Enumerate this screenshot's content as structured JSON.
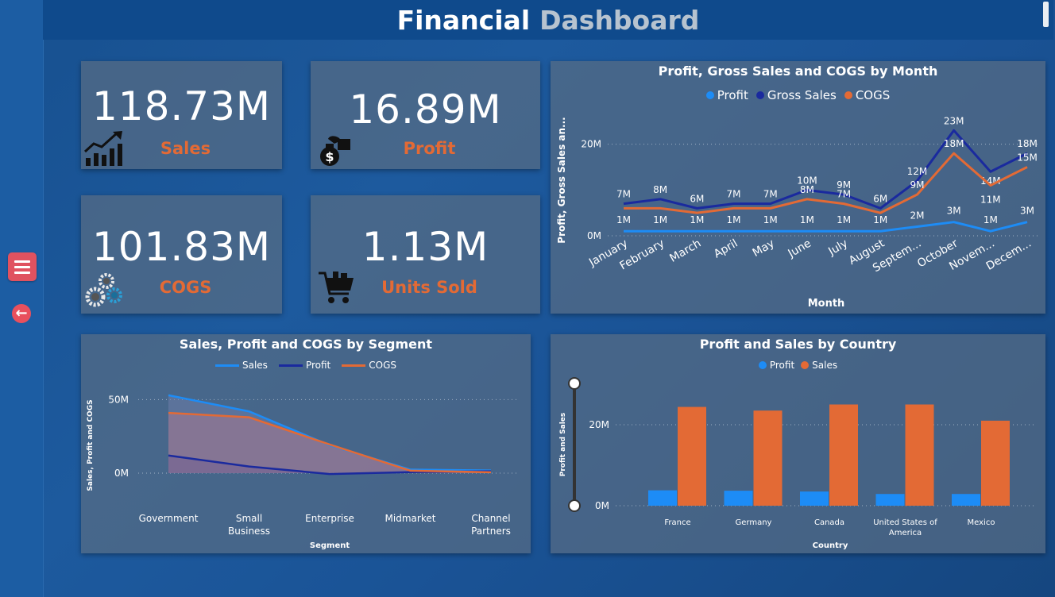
{
  "header": {
    "title_word1": "Financial",
    "title_word2": "Dashboard"
  },
  "kpis": {
    "sales": {
      "value": "118.73M",
      "label": "Sales"
    },
    "profit": {
      "value": "16.89M",
      "label": "Profit"
    },
    "cogs": {
      "value": "101.83M",
      "label": "COGS"
    },
    "units": {
      "value": "1.13M",
      "label": "Units Sold"
    }
  },
  "icons": {
    "sales": "chart-growth-icon",
    "profit": "money-bag-icon",
    "cogs": "gears-icon",
    "units": "shopping-cart-icon",
    "menu": "hamburger-menu-icon",
    "back": "back-arrow-icon"
  },
  "colors": {
    "accent_orange": "#e36a35",
    "profit_blue": "#1d8cf6",
    "gross_sales_navy": "#1a2a9e",
    "cogs_orange": "#e36a35"
  },
  "chart_data": [
    {
      "type": "line",
      "title": "Profit, Gross Sales and COGS by Month",
      "xlabel": "Month",
      "ylabel": "Profit, Gross Sales an...",
      "categories": [
        "January",
        "February",
        "March",
        "April",
        "May",
        "June",
        "July",
        "August",
        "Septem...",
        "October",
        "Novem...",
        "Decem..."
      ],
      "yticks": [
        "0M",
        "20M"
      ],
      "ylim": [
        0,
        26
      ],
      "legend_position": "top-center",
      "series": [
        {
          "name": "Profit",
          "color": "#1d8cf6",
          "values": [
            1,
            1,
            1,
            1,
            1,
            1,
            1,
            1,
            2,
            3,
            1,
            3
          ],
          "labels": [
            "1M",
            "1M",
            "1M",
            "1M",
            "1M",
            "1M",
            "1M",
            "1M",
            "2M",
            "3M",
            "1M",
            "3M"
          ]
        },
        {
          "name": "Gross Sales",
          "color": "#1a2a9e",
          "values": [
            7,
            8,
            6,
            7,
            7,
            10,
            9,
            6,
            12,
            23,
            14,
            18
          ],
          "labels": [
            "7M",
            "8M",
            "6M",
            "7M",
            "7M",
            "10M",
            "9M",
            "6M",
            "12M",
            "23M",
            "14M",
            "18M"
          ]
        },
        {
          "name": "COGS",
          "color": "#e36a35",
          "values": [
            6,
            6,
            5,
            6,
            6,
            8,
            7,
            5,
            9,
            18,
            11,
            15
          ],
          "labels": [
            "",
            "",
            "",
            "",
            "",
            "8M",
            "7M",
            "",
            "9M",
            "18M",
            "11M",
            "15M"
          ]
        }
      ]
    },
    {
      "type": "area",
      "title": "Sales, Profit and COGS by Segment",
      "xlabel": "Segment",
      "ylabel": "Sales, Profit and COGS",
      "categories": [
        "Government",
        "Small Business",
        "Enterprise",
        "Midmarket",
        "Channel Partners"
      ],
      "category_lines": [
        [
          "Government"
        ],
        [
          "Small",
          "Business"
        ],
        [
          "Enterprise"
        ],
        [
          "Midmarket"
        ],
        [
          "Channel",
          "Partners"
        ]
      ],
      "yticks": [
        "0M",
        "50M"
      ],
      "ylim": [
        0,
        56
      ],
      "legend_position": "top-center",
      "series": [
        {
          "name": "Sales",
          "color": "#1d8cf6",
          "values": [
            53,
            42,
            19,
            2.4,
            1.8
          ]
        },
        {
          "name": "Profit",
          "color": "#1a2a9e",
          "values": [
            12,
            4.5,
            -0.6,
            0.7,
            1.3
          ]
        },
        {
          "name": "COGS",
          "color": "#e36a35",
          "values": [
            41,
            38,
            19.5,
            1.7,
            0.6
          ]
        }
      ]
    },
    {
      "type": "bar",
      "title": "Profit and Sales by Country",
      "xlabel": "Country",
      "ylabel": "Profit and Sales",
      "categories": [
        "France",
        "Germany",
        "Canada",
        "United States of America",
        "Mexico"
      ],
      "category_lines": [
        [
          "France"
        ],
        [
          "Germany"
        ],
        [
          "Canada"
        ],
        [
          "United States of",
          "America"
        ],
        [
          "Mexico"
        ]
      ],
      "yticks": [
        "0M",
        "20M"
      ],
      "ylim": [
        0,
        30
      ],
      "legend_position": "top-center",
      "series": [
        {
          "name": "Profit",
          "color": "#1d8cf6",
          "values": [
            3.8,
            3.7,
            3.5,
            2.9,
            2.9
          ]
        },
        {
          "name": "Sales",
          "color": "#e36a35",
          "values": [
            24.4,
            23.5,
            25.0,
            25.0,
            21.0
          ]
        }
      ]
    }
  ]
}
